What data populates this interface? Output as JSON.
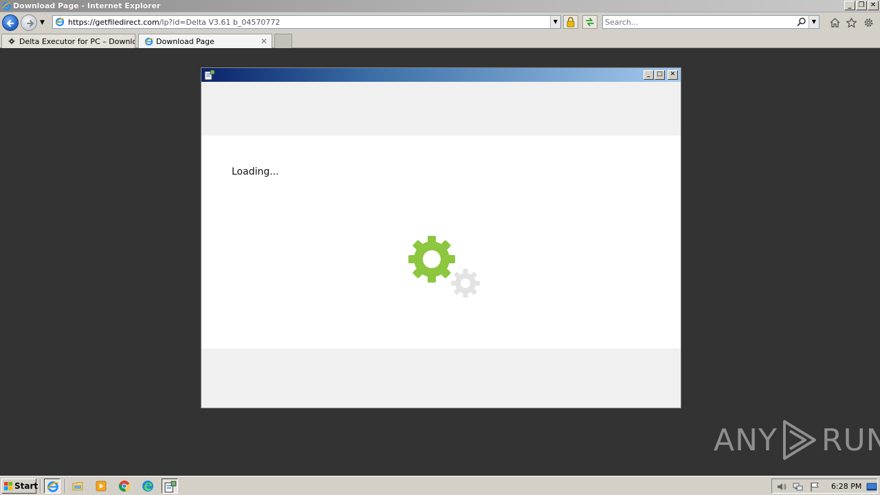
{
  "browser": {
    "window_title": "Download Page - Internet Explorer",
    "address_domain": "https://getfiledirect.com",
    "address_path": "/lp?id=Delta V3.61 b_04570772",
    "search_placeholder": "Search...",
    "tabs": [
      {
        "label": "Delta Executor for PC – Downlo...",
        "active": false
      },
      {
        "label": "Download Page",
        "active": true
      }
    ],
    "tab_close_glyph": "✕"
  },
  "app_window": {
    "loading_text": "Loading..."
  },
  "watermark": {
    "left": "ANY",
    "right": "RUN"
  },
  "taskbar": {
    "start_label": "Start",
    "clock": "6:28 PM",
    "pinned": [
      "ie-icon",
      "explorer-icon",
      "media-player-icon",
      "chrome-icon",
      "edge-icon",
      "installer-icon"
    ]
  },
  "colors": {
    "gear_primary": "#8dc63f",
    "gear_secondary": "#e3e3e3",
    "desktop_bg": "#333333",
    "title_gradient_start": "#0a246a",
    "title_gradient_end": "#a6caf0"
  }
}
